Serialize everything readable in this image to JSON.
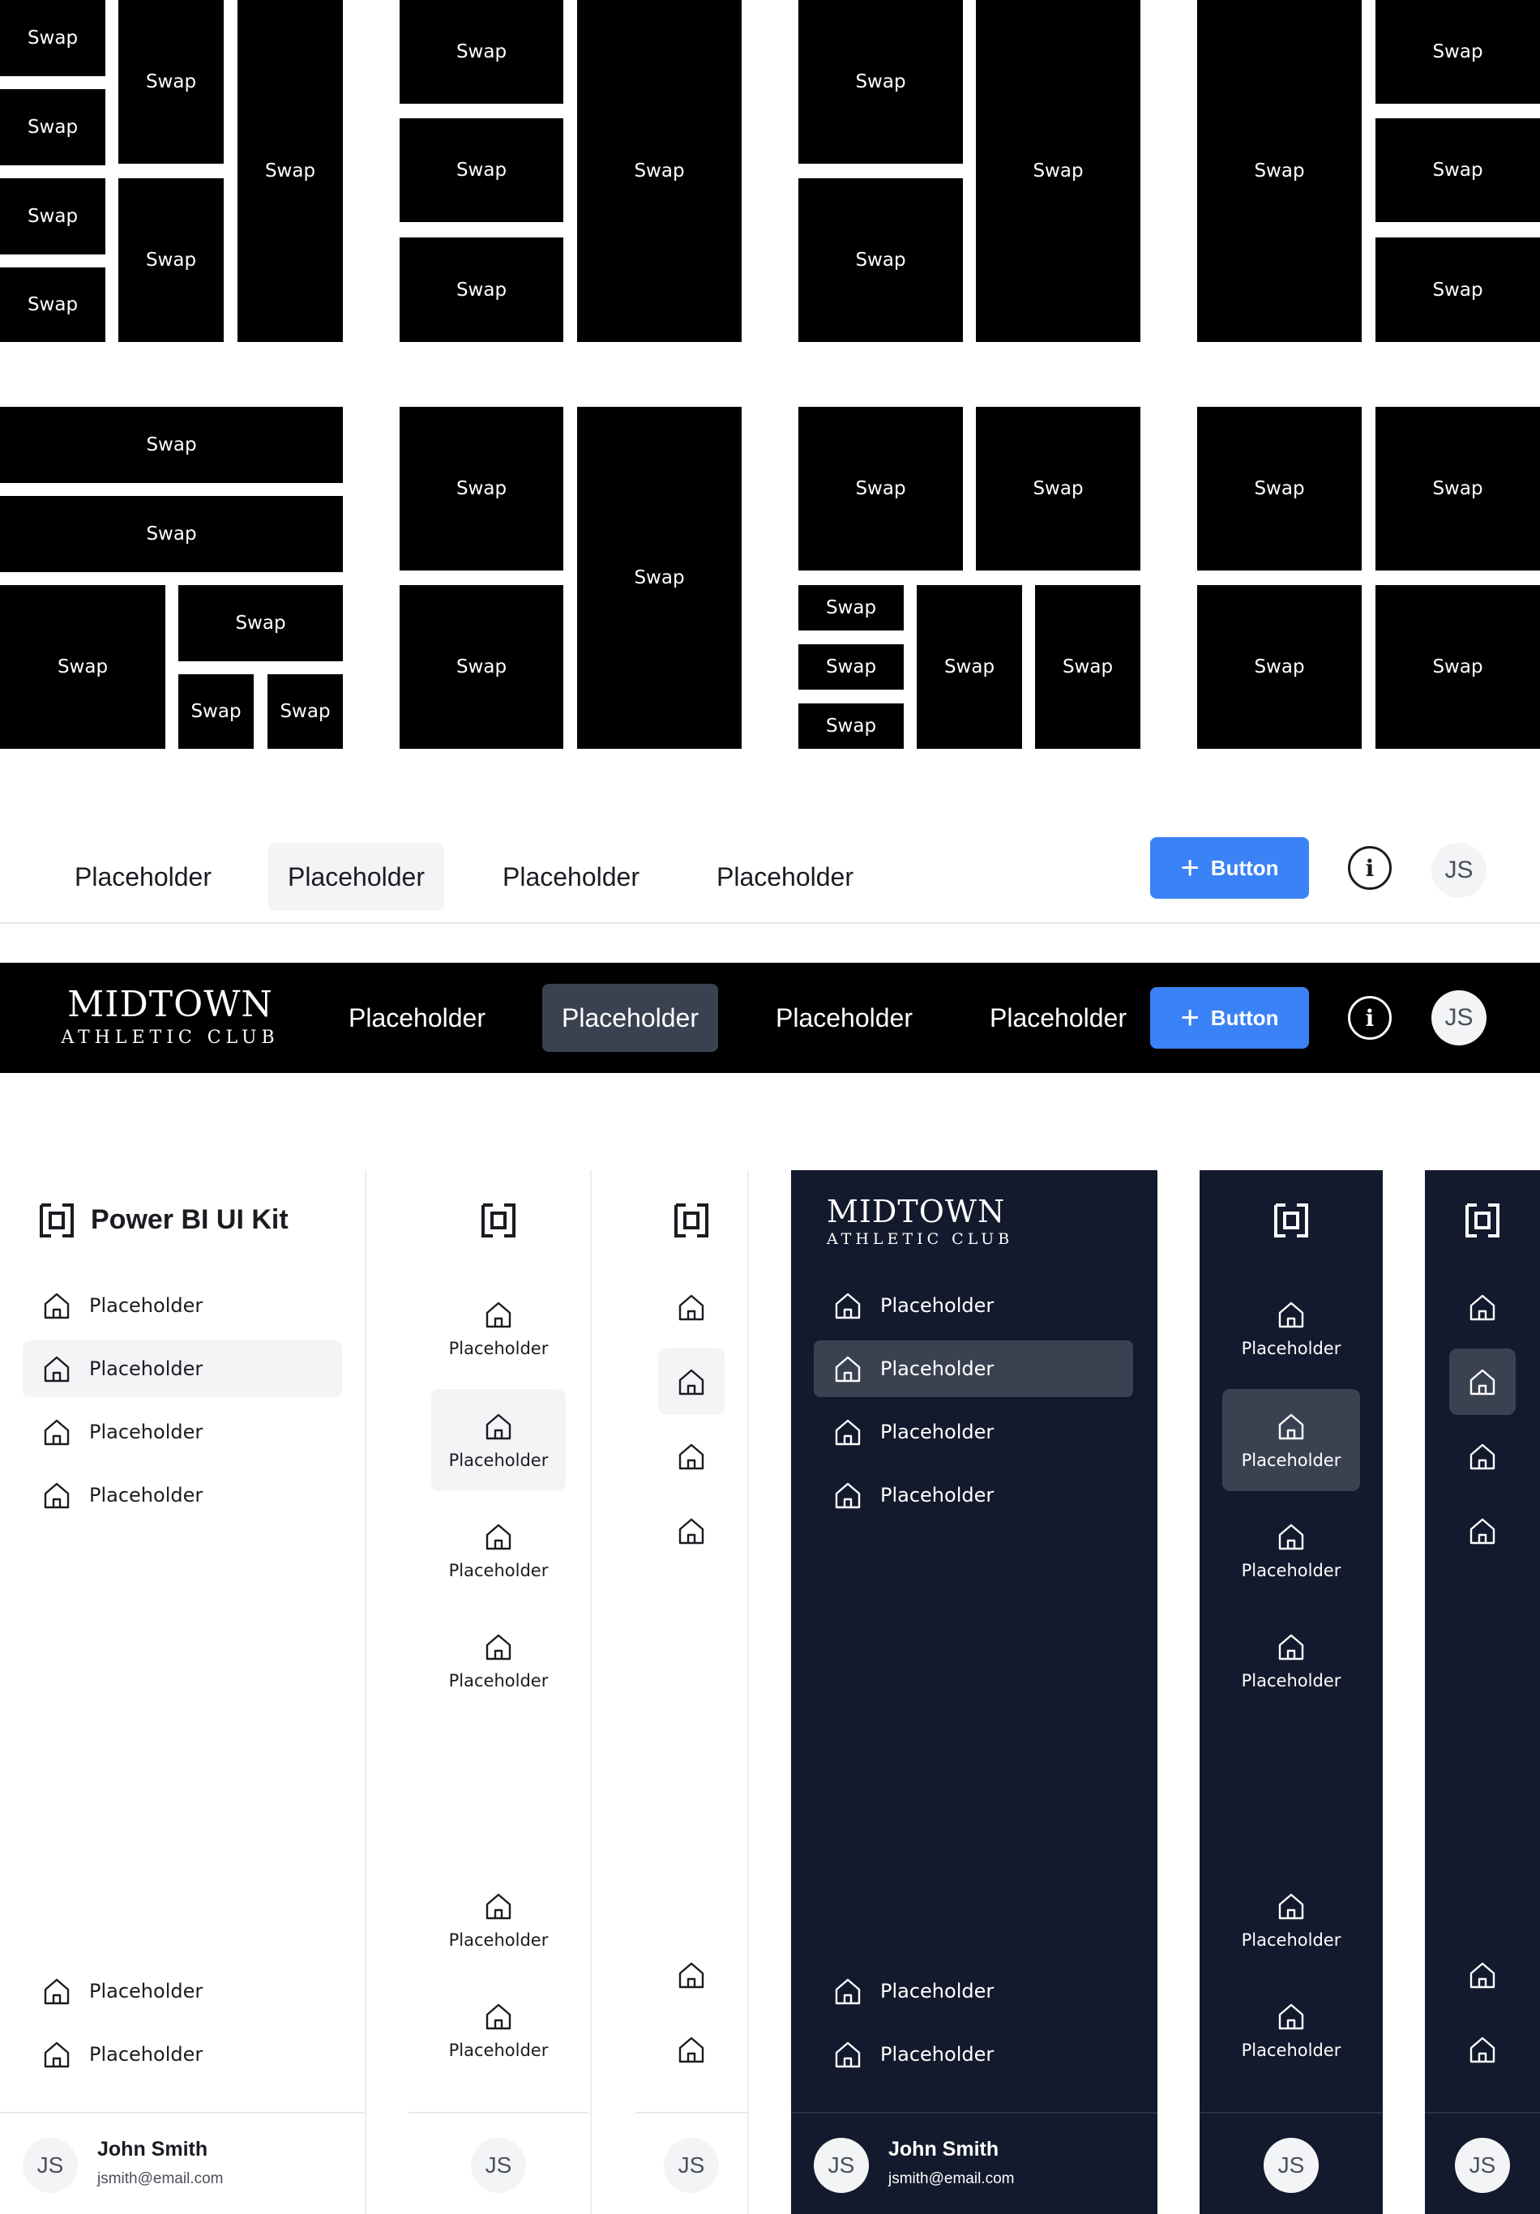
{
  "swap_label": "Swap",
  "grids": [
    {
      "name": "grid-1",
      "cells": [
        "Swap",
        "Swap",
        "Swap",
        "Swap",
        "Swap",
        "Swap",
        "Swap"
      ]
    },
    {
      "name": "grid-2",
      "cells": [
        "Swap",
        "Swap",
        "Swap",
        "Swap"
      ]
    },
    {
      "name": "grid-3",
      "cells": [
        "Swap",
        "Swap",
        "Swap"
      ]
    },
    {
      "name": "grid-4",
      "cells": [
        "Swap",
        "Swap",
        "Swap",
        "Swap"
      ]
    },
    {
      "name": "grid-5",
      "cells": [
        "Swap",
        "Swap",
        "Swap",
        "Swap",
        "Swap"
      ]
    },
    {
      "name": "grid-6",
      "cells": [
        "Swap",
        "Swap",
        "Swap"
      ]
    },
    {
      "name": "grid-7",
      "cells": [
        "Swap",
        "Swap",
        "Swap",
        "Swap",
        "Swap",
        "Swap",
        "Swap"
      ]
    },
    {
      "name": "grid-8",
      "cells": [
        "Swap",
        "Swap",
        "Swap",
        "Swap"
      ]
    }
  ],
  "nav_light": {
    "tabs": [
      "Placeholder",
      "Placeholder",
      "Placeholder",
      "Placeholder"
    ],
    "active_index": 1,
    "button_label": "Button",
    "avatar_initials": "JS"
  },
  "nav_dark": {
    "logo_main": "MIDTOWN",
    "logo_sub": "ATHLETIC CLUB",
    "tabs": [
      "Placeholder",
      "Placeholder",
      "Placeholder",
      "Placeholder"
    ],
    "active_index": 1,
    "button_label": "Button",
    "avatar_initials": "JS"
  },
  "sidebars": {
    "brand_title": "Power BI UI Kit",
    "dark_logo_main": "MIDTOWN",
    "dark_logo_sub": "ATHLETIC CLUB",
    "item_label": "Placeholder",
    "user_name": "John Smith",
    "user_email": "jsmith@email.com",
    "avatar_initials": "JS"
  },
  "colors": {
    "accent": "#3b82f6",
    "dark_bg": "#141a2d",
    "active_dark": "#3a4252",
    "active_light": "#f3f4f6",
    "swap_block": "#000000"
  },
  "icons": {
    "nav_item": "home-icon",
    "brand": "power-bi-icon",
    "info": "info-icon",
    "add": "plus-icon"
  }
}
